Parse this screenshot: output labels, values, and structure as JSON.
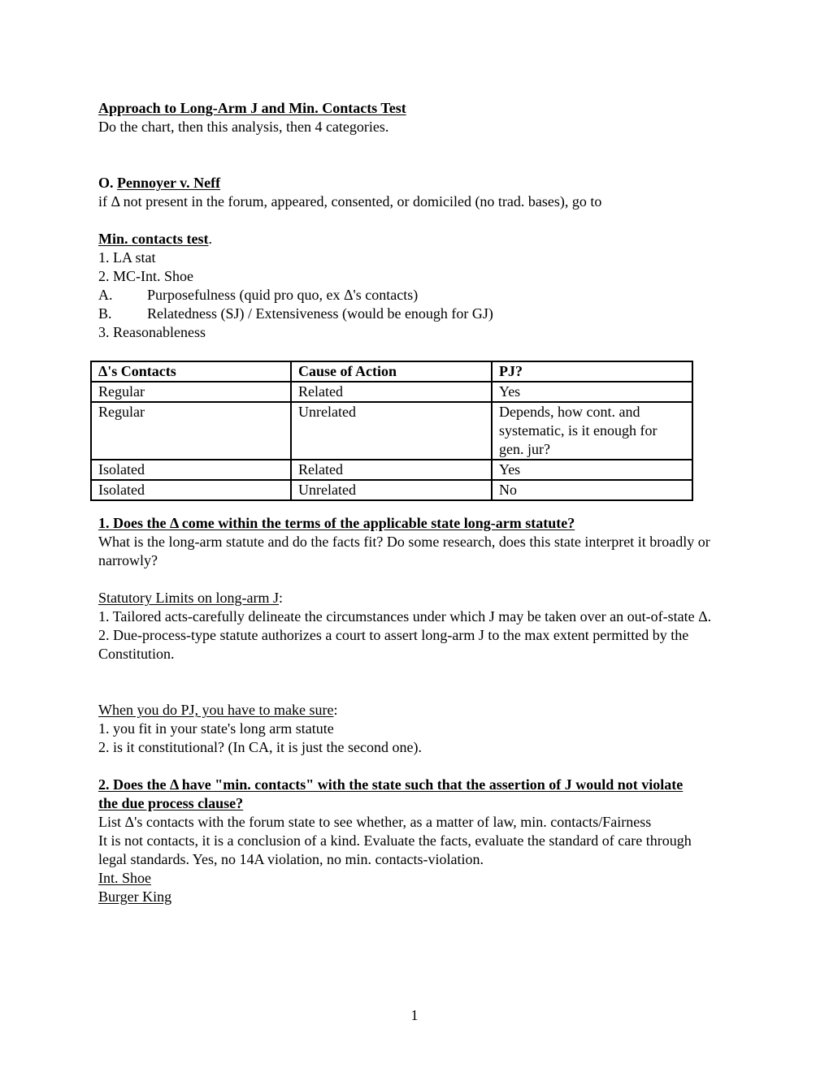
{
  "header": {
    "title": "Approach to Long-Arm J and Min. Contacts Test",
    "subtitle": "Do the chart, then this analysis, then 4 categories."
  },
  "pennoyer": {
    "prefix": "O. ",
    "case": "Pennoyer v. Neff",
    "text": "if Δ not present in the forum, appeared, consented, or domiciled (no trad. bases), go to"
  },
  "min_contacts": {
    "heading": "Min. contacts test",
    "heading_suffix": ".",
    "items": [
      {
        "text": "1. LA stat"
      },
      {
        "text": "2. MC-Int. Shoe"
      },
      {
        "marker": "A.",
        "text": "Purposefulness (quid pro quo, ex Δ's contacts)"
      },
      {
        "marker": "B.",
        "text": "Relatedness (SJ) / Extensiveness (would be enough for GJ)"
      },
      {
        "text": "3. Reasonableness"
      }
    ]
  },
  "table": {
    "headers": [
      "Δ's Contacts",
      "Cause of Action",
      "PJ?"
    ],
    "rows": [
      [
        "Regular",
        "Related",
        "Yes"
      ],
      [
        "Regular",
        "Unrelated",
        "Depends, how cont. and systematic, is it enough for gen. jur?"
      ],
      [
        "Isolated",
        "Related",
        "Yes"
      ],
      [
        "Isolated",
        "Unrelated",
        "No"
      ]
    ]
  },
  "section1": {
    "heading": "1. Does the Δ come within the terms of the applicable state long-arm statute?",
    "body": "What is the long-arm statute and do the facts fit? Do some research, does this state interpret it broadly or narrowly?"
  },
  "statutory_limits": {
    "heading": "Statutory Limits on long-arm J",
    "heading_suffix": ":",
    "item1": "1. Tailored acts-carefully delineate the circumstances under which J may be taken over an out-of-state Δ.",
    "item2": "2. Due-process-type statute authorizes a court to assert long-arm J to the max extent permitted by the Constitution."
  },
  "when_pj": {
    "heading": "When you do PJ, you have to make sure",
    "heading_suffix": ":",
    "item1": "1. you fit in your state's long arm statute",
    "item2": "2. is it constitutional? (In CA, it is just the second one)."
  },
  "section2": {
    "heading": "2. Does the Δ have \"min. contacts\" with the state such that the assertion of J would not violate the due process clause? ",
    "line1": "List Δ's contacts with the forum state to see whether, as a matter of law, min. contacts/Fairness",
    "body": "It is not contacts, it is a conclusion of a kind. Evaluate the facts, evaluate the standard of care through legal standards. Yes, no 14A violation, no min. contacts-violation.",
    "cases": [
      "Int. Shoe",
      "Burger King"
    ]
  },
  "footer": {
    "page_number": "1"
  }
}
